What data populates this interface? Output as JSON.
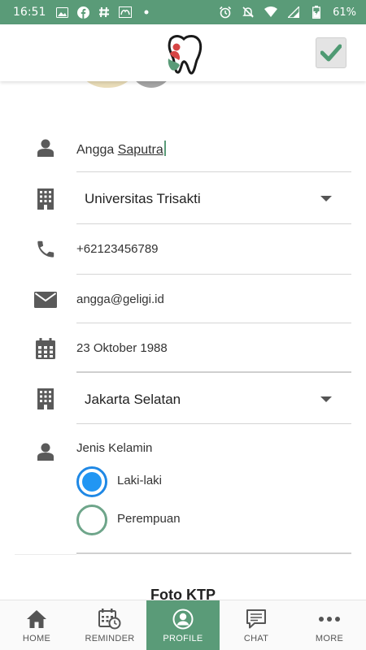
{
  "status_bar": {
    "time": "16:51",
    "battery": "61%"
  },
  "header": {
    "logo_icon": "tooth-logo-icon",
    "save_icon": "checkmark-icon"
  },
  "form": {
    "name_first": "Angga",
    "name_second": "Saputra",
    "university": "Universitas Trisakti",
    "phone": "+62123456789",
    "email": "angga@geligi.id",
    "birth_date": "23 Oktober 1988",
    "city": "Jakarta Selatan",
    "gender_label": "Jenis Kelamin",
    "gender_options": [
      {
        "label": "Laki-laki",
        "selected": true
      },
      {
        "label": "Perempuan",
        "selected": false
      }
    ]
  },
  "section": {
    "ktp_title": "Foto KTP"
  },
  "bottom_nav": [
    {
      "label": "HOME",
      "icon": "home-icon",
      "active": false
    },
    {
      "label": "REMINDER",
      "icon": "calendar-clock-icon",
      "active": false
    },
    {
      "label": "PROFILE",
      "icon": "profile-icon",
      "active": true
    },
    {
      "label": "CHAT",
      "icon": "chat-icon",
      "active": false
    },
    {
      "label": "MORE",
      "icon": "more-icon",
      "active": false
    }
  ],
  "colors": {
    "primary": "#5a9b78",
    "radio_selected": "#2196f3",
    "radio_unselected": "#6ea58a"
  }
}
